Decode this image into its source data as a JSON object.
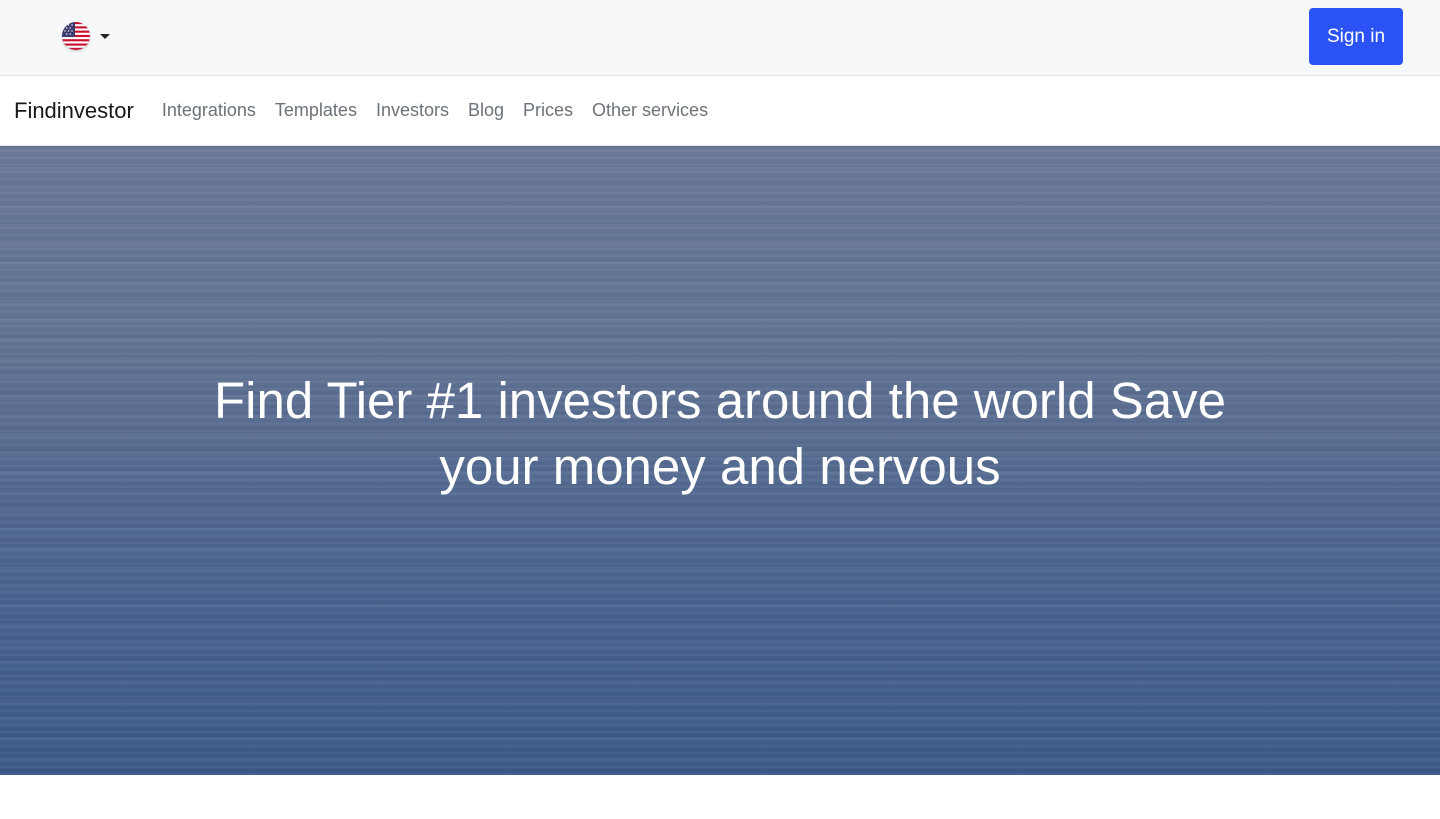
{
  "header": {
    "language": {
      "flag_icon": "us-flag-icon",
      "dropdown_icon": "caret-down-icon"
    },
    "signin_label": "Sign in",
    "signin_color": "#2b52f5"
  },
  "navbar": {
    "brand": "Findinvestor",
    "links": [
      "Integrations",
      "Templates",
      "Investors",
      "Blog",
      "Prices",
      "Other services"
    ]
  },
  "hero": {
    "title": "Find Tier #1 investors around the world Save your money and nervous"
  }
}
